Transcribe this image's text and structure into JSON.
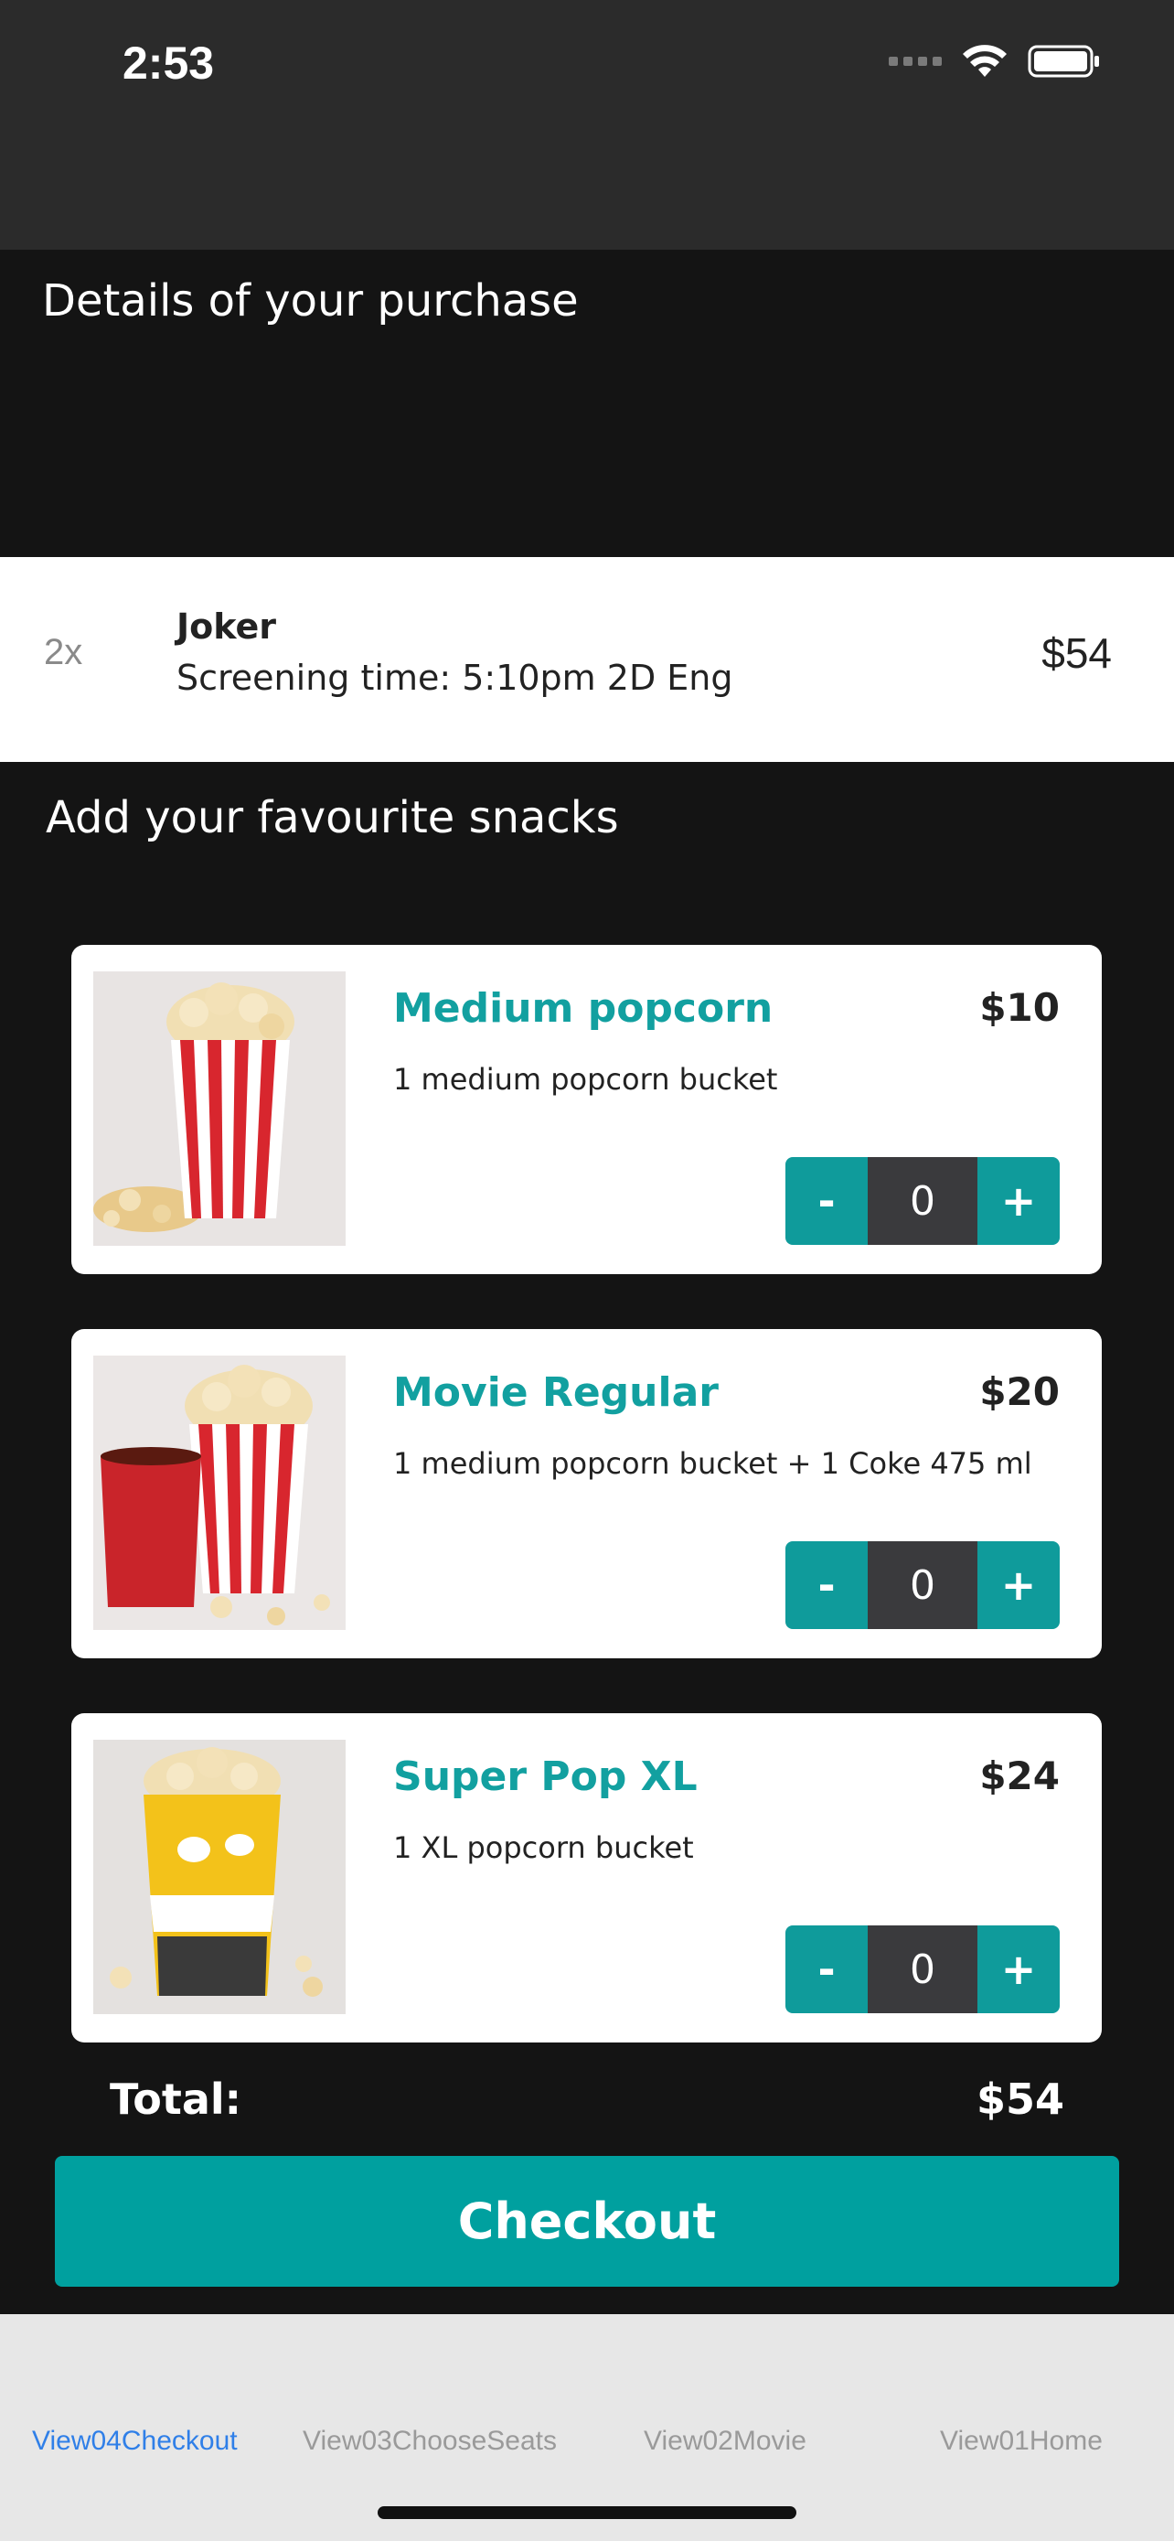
{
  "status_bar": {
    "time": "2:53"
  },
  "purchase": {
    "title": "Details of your purchase",
    "ticket": {
      "quantity": "2x",
      "movie": "Joker",
      "screening": "Screening time: 5:10pm 2D Eng",
      "price": "$54"
    }
  },
  "snacks": {
    "title": "Add your favourite snacks",
    "items": [
      {
        "name": "Medium popcorn",
        "price": "$10",
        "description": "1 medium popcorn bucket",
        "quantity": "0",
        "minus": "-",
        "plus": "+"
      },
      {
        "name": "Movie Regular",
        "price": "$20",
        "description": "1 medium popcorn bucket + 1 Coke 475 ml",
        "quantity": "0",
        "minus": "-",
        "plus": "+"
      },
      {
        "name": "Super Pop XL",
        "price": "$24",
        "description": "1 XL popcorn bucket",
        "quantity": "0",
        "minus": "-",
        "plus": "+"
      }
    ]
  },
  "total": {
    "label": "Total:",
    "value": "$54"
  },
  "checkout": {
    "label": "Checkout"
  },
  "tabs": [
    {
      "label": "View04Checkout",
      "active": true
    },
    {
      "label": "View03ChooseSeats",
      "active": false
    },
    {
      "label": "View02Movie",
      "active": false
    },
    {
      "label": "View01Home",
      "active": false
    }
  ],
  "colors": {
    "accent": "#00a09f",
    "tab_active": "#2f7fe8",
    "background": "#141414"
  }
}
